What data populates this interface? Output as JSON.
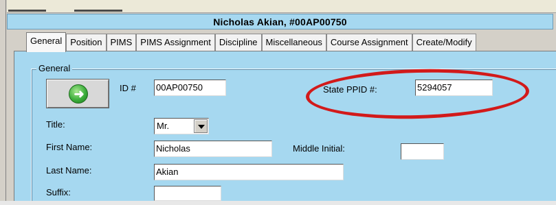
{
  "record": {
    "title": "Nicholas  Akian, #00AP00750"
  },
  "tabs": [
    {
      "label": "General",
      "active": true
    },
    {
      "label": "Position",
      "active": false
    },
    {
      "label": "PIMS",
      "active": false
    },
    {
      "label": "PIMS Assignment",
      "active": false
    },
    {
      "label": "Discipline",
      "active": false
    },
    {
      "label": "Miscellaneous",
      "active": false
    },
    {
      "label": "Course Assignment",
      "active": false
    },
    {
      "label": "Create/Modify",
      "active": false
    }
  ],
  "general": {
    "group_label": "General",
    "next_icon": "green-arrow-right-icon",
    "id_label": "ID #",
    "id_value": "00AP00750",
    "state_ppid_label": "State PPID #:",
    "state_ppid_value": "5294057",
    "title_label": "Title:",
    "title_value": "Mr.",
    "first_name_label": "First Name:",
    "first_name_value": "Nicholas",
    "middle_initial_label": "Middle Initial:",
    "middle_initial_value": "",
    "last_name_label": "Last Name:",
    "last_name_value": "Akian",
    "suffix_label": "Suffix:",
    "suffix_value": ""
  },
  "colors": {
    "panel_background": "#a6d8f0",
    "highlight_oval": "#d21a1a",
    "tab_background": "#f2f2f2"
  }
}
